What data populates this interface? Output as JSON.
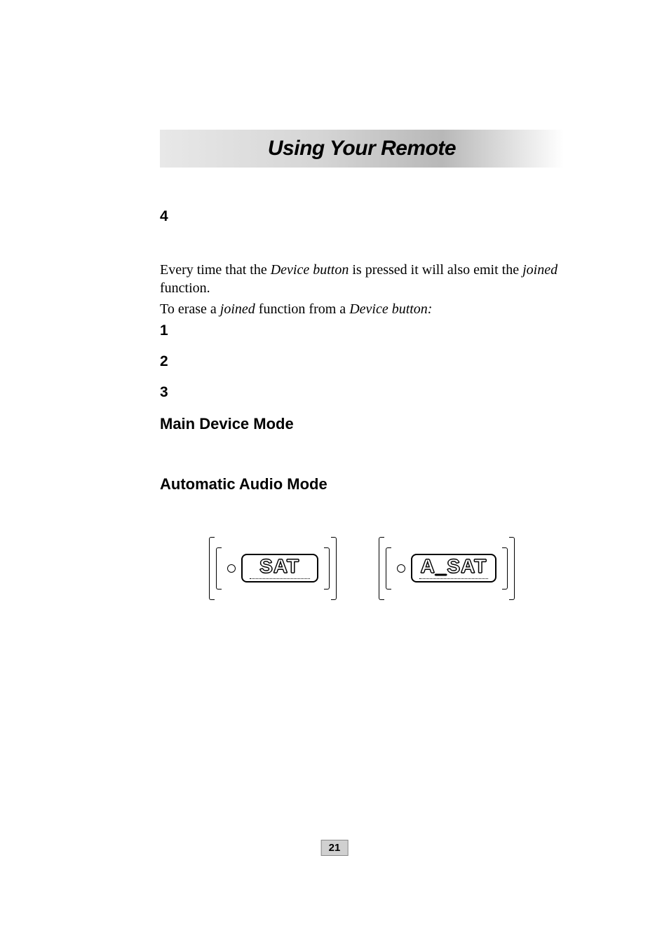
{
  "title": "Using Your Remote",
  "step4_number": "4",
  "body": {
    "para1_a": "Every time that the ",
    "para1_b": "Device button",
    "para1_c": " is pressed it will also emit the ",
    "para1_d": "joined",
    "para1_e": " function.",
    "para2_a": "To erase a ",
    "para2_b": "joined",
    "para2_c": " function from a ",
    "para2_d": "Device button:"
  },
  "substeps": {
    "s1": "1",
    "s2": "2",
    "s3": "3"
  },
  "headings": {
    "main_device": "Main Device Mode",
    "audio_mode": "Automatic Audio Mode"
  },
  "lcd": {
    "left": "SAT",
    "right": "A_SAT"
  },
  "page_number": "21"
}
